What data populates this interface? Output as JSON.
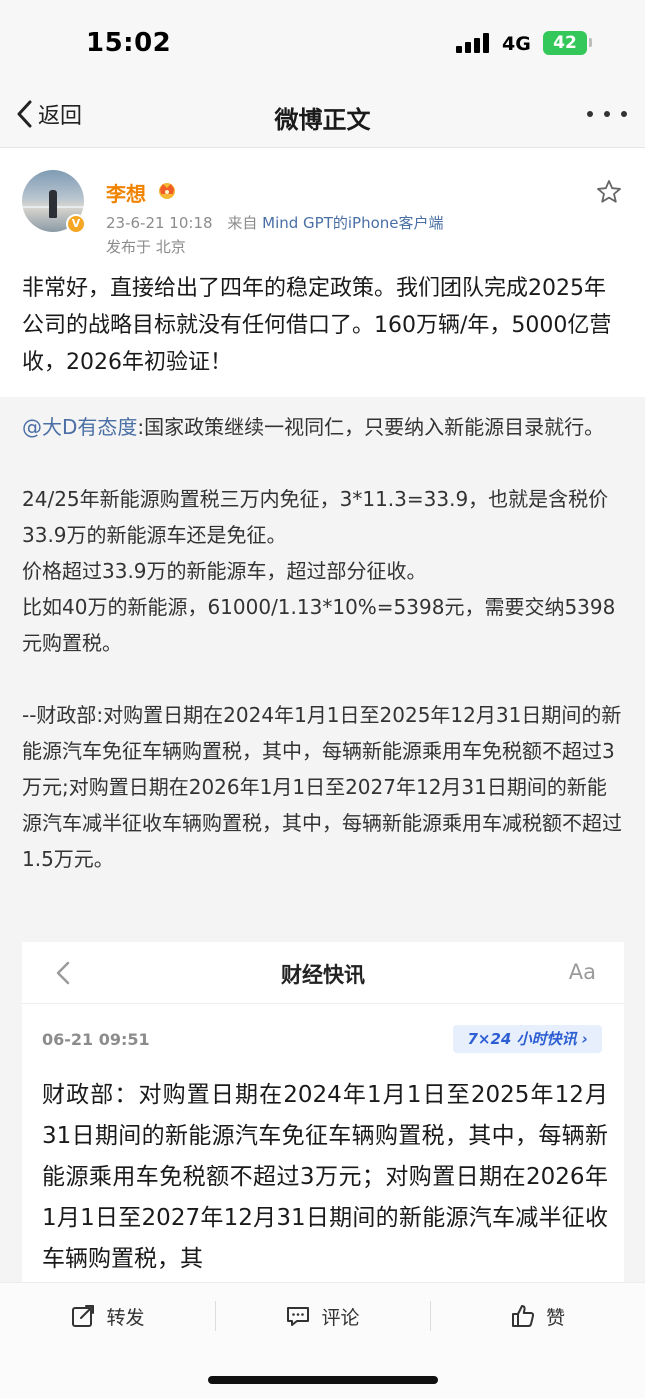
{
  "status_bar": {
    "time": "15:02",
    "network": "4G",
    "battery": "42"
  },
  "nav": {
    "back_label": "返回",
    "title": "微博正文"
  },
  "post": {
    "author": "李想",
    "date": "23-6-21 10:18",
    "source_prefix": "来自",
    "source": "Mind GPT的iPhone客户端",
    "location": "发布于 北京",
    "content": "非常好，直接给出了四年的稳定政策。我们团队完成2025年公司的战略目标就没有任何借口了。160万辆/年，5000亿营收，2026年初验证！"
  },
  "repost": {
    "mention": "@大D有态度",
    "lead": ":国家政策继续一视同仁，只要纳入新能源目录就行。",
    "paragraph_2": "24/25年新能源购置税三万内免征，3*11.3=33.9，也就是含税价33.9万的新能源车还是免征。\n价格超过33.9万的新能源车，超过部分征收。\n比如40万的新能源，61000/1.13*10%=5398元，需要交纳5398元购置税。",
    "paragraph_3": "--财政部:对购置日期在2024年1月1日至2025年12月31日期间的新能源汽车免征车辆购置税，其中，每辆新能源乘用车免税额不超过3万元;对购置日期在2026年1月1日至2027年12月31日期间的新能源汽车减半征收车辆购置税，其中，每辆新能源乘用车减税额不超过1.5万元。"
  },
  "news_card": {
    "title": "财经快讯",
    "font_button": "Aa",
    "date": "06-21 09:51",
    "badge": "7×24 小时快讯 ›",
    "text": "财政部：对购置日期在2024年1月1日至2025年12月31日期间的新能源汽车免征车辆购置税，其中，每辆新能源乘用车免税额不超过3万元；对购置日期在2026年1月1日至2027年12月31日期间的新能源汽车减半征收车辆购置税，其"
  },
  "actions": {
    "repost": "转发",
    "comment": "评论",
    "like": "赞"
  },
  "icons": {
    "back": "chevron-left-icon",
    "more": "more-icon",
    "crown": "crown-icon",
    "star": "star-icon",
    "repost": "repost-icon",
    "comment": "comment-icon",
    "like": "thumbs-up-icon"
  },
  "colors": {
    "author_orange": "#f08300",
    "link_blue": "#4a6fa5",
    "battery_green": "#34c759",
    "badge_blue": "#2d5fd3"
  }
}
